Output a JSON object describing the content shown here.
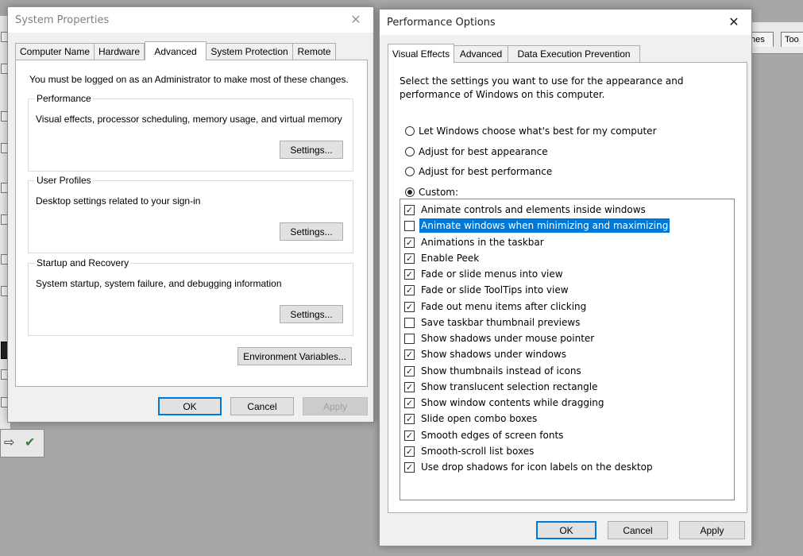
{
  "background_app": {
    "tabs": [
      "hes",
      "Too"
    ]
  },
  "system_properties": {
    "title": "System Properties",
    "close_glyph": "✕",
    "tabs": [
      {
        "label": "Computer Name"
      },
      {
        "label": "Hardware"
      },
      {
        "label": "Advanced"
      },
      {
        "label": "System Protection"
      },
      {
        "label": "Remote"
      }
    ],
    "active_tab": "Advanced",
    "admin_notice": "You must be logged on as an Administrator to make most of these changes.",
    "performance": {
      "title": "Performance",
      "description": "Visual effects, processor scheduling, memory usage, and virtual memory",
      "button": "Settings..."
    },
    "user_profiles": {
      "title": "User Profiles",
      "description": "Desktop settings related to your sign-in",
      "button": "Settings..."
    },
    "startup_recovery": {
      "title": "Startup and Recovery",
      "description": "System startup, system failure, and debugging information",
      "button": "Settings..."
    },
    "env_button": "Environment Variables...",
    "ok": "OK",
    "cancel": "Cancel",
    "apply": "Apply"
  },
  "performance_options": {
    "title": "Performance Options",
    "close_glyph": "✕",
    "tabs": [
      {
        "label": "Visual Effects"
      },
      {
        "label": "Advanced"
      },
      {
        "label": "Data Execution Prevention"
      }
    ],
    "active_tab": "Visual Effects",
    "intro": [
      "Select the settings you want to use for the appearance and",
      "performance of Windows on this computer."
    ],
    "radios": [
      {
        "label": "Let Windows choose what's best for my computer",
        "checked": false
      },
      {
        "label": "Adjust for best appearance",
        "checked": false
      },
      {
        "label": "Adjust for best performance",
        "checked": false
      },
      {
        "label": "Custom:",
        "checked": true
      }
    ],
    "effects": [
      {
        "label": "Animate controls and elements inside windows",
        "checked": true
      },
      {
        "label": "Animate windows when minimizing and maximizing",
        "checked": false,
        "selected": true
      },
      {
        "label": "Animations in the taskbar",
        "checked": true
      },
      {
        "label": "Enable Peek",
        "checked": true
      },
      {
        "label": "Fade or slide menus into view",
        "checked": true
      },
      {
        "label": "Fade or slide ToolTips into view",
        "checked": true
      },
      {
        "label": "Fade out menu items after clicking",
        "checked": true
      },
      {
        "label": "Save taskbar thumbnail previews",
        "checked": false
      },
      {
        "label": "Show shadows under mouse pointer",
        "checked": false
      },
      {
        "label": "Show shadows under windows",
        "checked": true
      },
      {
        "label": "Show thumbnails instead of icons",
        "checked": true
      },
      {
        "label": "Show translucent selection rectangle",
        "checked": true
      },
      {
        "label": "Show window contents while dragging",
        "checked": true
      },
      {
        "label": "Slide open combo boxes",
        "checked": true
      },
      {
        "label": "Smooth edges of screen fonts",
        "checked": true
      },
      {
        "label": "Smooth-scroll list boxes",
        "checked": true
      },
      {
        "label": "Use drop shadows for icon labels on the desktop",
        "checked": true
      }
    ],
    "ok": "OK",
    "cancel": "Cancel",
    "apply": "Apply"
  }
}
